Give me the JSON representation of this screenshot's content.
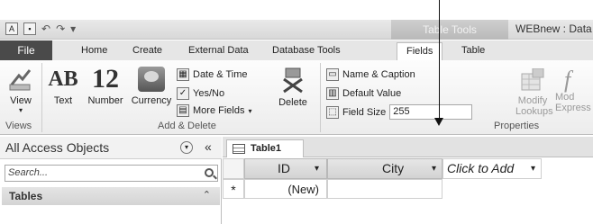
{
  "window": {
    "context_tab": "Table Tools",
    "app_title": "WEBnew : Data"
  },
  "tabs": {
    "file": "File",
    "items": [
      "Home",
      "Create",
      "External Data",
      "Database Tools",
      "Fields",
      "Table"
    ],
    "active": "Fields"
  },
  "ribbon": {
    "views": {
      "button": "View",
      "group": "Views"
    },
    "add_delete": {
      "text": "Text",
      "number": "Number",
      "number_icon": "12",
      "currency": "Currency",
      "date_time": "Date & Time",
      "yes_no": "Yes/No",
      "more_fields": "More Fields",
      "delete": "Delete",
      "group": "Add & Delete"
    },
    "properties": {
      "name_caption": "Name & Caption",
      "default_value": "Default Value",
      "field_size_label": "Field Size",
      "field_size_value": "255",
      "modify_lookups_1": "Modify",
      "modify_lookups_2": "Lookups",
      "modify_expression_1": "Mod",
      "modify_expression_2": "Express",
      "group": "Properties"
    }
  },
  "nav": {
    "title": "All Access Objects",
    "search_placeholder": "Search...",
    "section": "Tables"
  },
  "document": {
    "tab": "Table1",
    "columns": [
      "ID",
      "City",
      "Click to Add"
    ],
    "new_row": {
      "selector": "*",
      "id": "(New)"
    }
  }
}
